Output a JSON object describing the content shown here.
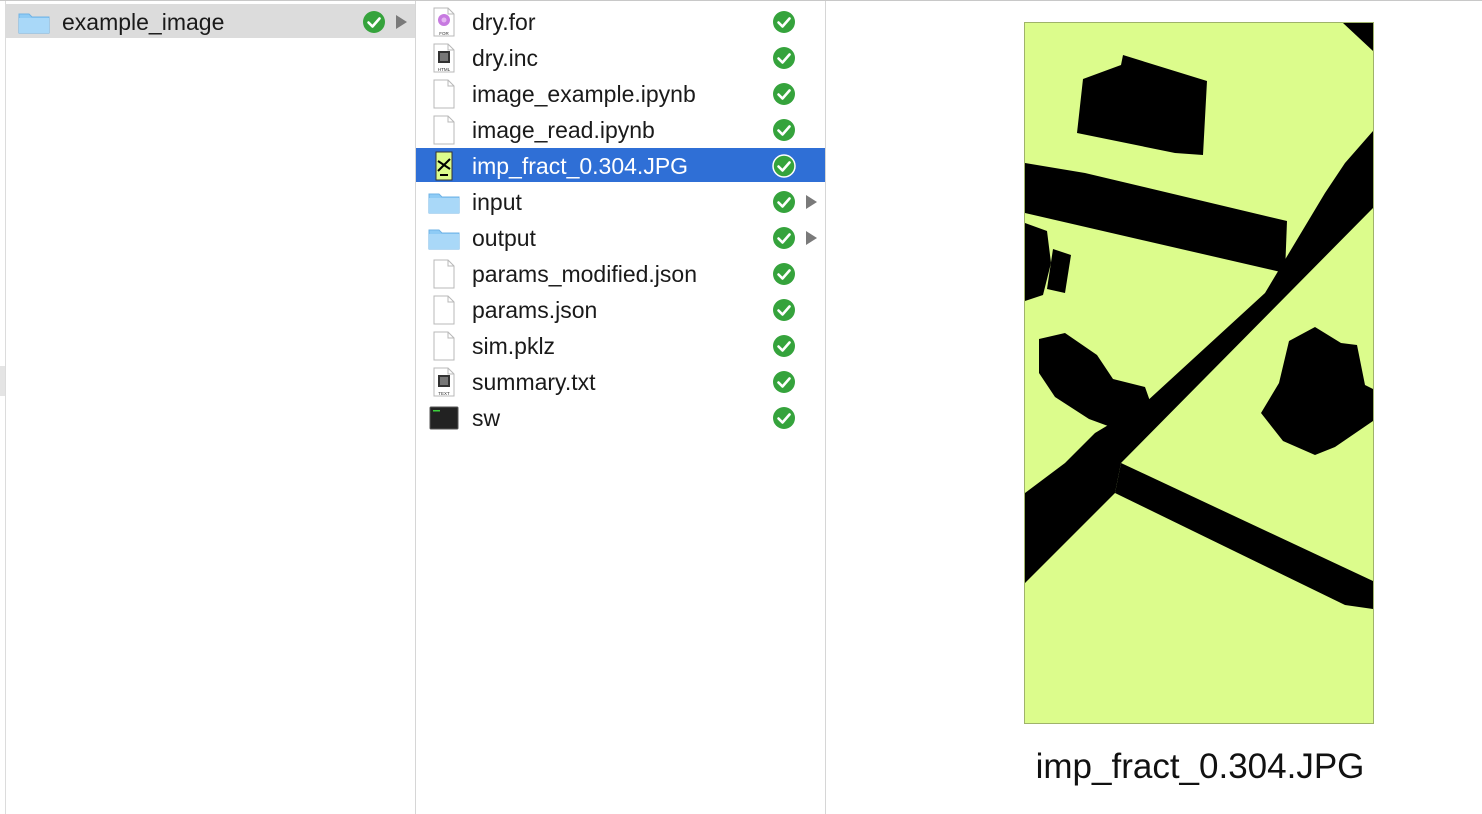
{
  "column1": {
    "items": [
      {
        "label": "example_image",
        "icon": "folder-icon",
        "synced": true,
        "has_children": true
      }
    ]
  },
  "column2": {
    "items": [
      {
        "label": "dry.for",
        "icon": "fortran-file-icon",
        "synced": true,
        "has_children": false,
        "selected": false,
        "icon_badge": "FOR"
      },
      {
        "label": "dry.inc",
        "icon": "html-file-icon",
        "synced": true,
        "has_children": false,
        "selected": false,
        "icon_badge": "HTML"
      },
      {
        "label": "image_example.ipynb",
        "icon": "blank-document-icon",
        "synced": true,
        "has_children": false,
        "selected": false
      },
      {
        "label": "image_read.ipynb",
        "icon": "blank-document-icon",
        "synced": true,
        "has_children": false,
        "selected": false
      },
      {
        "label": "imp_fract_0.304.JPG",
        "icon": "jpg-thumbnail-icon",
        "synced": true,
        "has_children": false,
        "selected": true
      },
      {
        "label": "input",
        "icon": "folder-icon",
        "synced": true,
        "has_children": true,
        "selected": false
      },
      {
        "label": "output",
        "icon": "folder-icon",
        "synced": true,
        "has_children": true,
        "selected": false
      },
      {
        "label": "params_modified.json",
        "icon": "blank-document-icon",
        "synced": true,
        "has_children": false,
        "selected": false
      },
      {
        "label": "params.json",
        "icon": "blank-document-icon",
        "synced": true,
        "has_children": false,
        "selected": false
      },
      {
        "label": "sim.pklz",
        "icon": "blank-document-icon",
        "synced": true,
        "has_children": false,
        "selected": false
      },
      {
        "label": "summary.txt",
        "icon": "text-file-icon",
        "synced": true,
        "has_children": false,
        "selected": false,
        "icon_badge": "TEXT"
      },
      {
        "label": "sw",
        "icon": "terminal-executable-icon",
        "synced": true,
        "has_children": false,
        "selected": false
      }
    ]
  },
  "preview": {
    "caption": "imp_fract_0.304.JPG",
    "image_background": "#dcfc8c",
    "image_foreground": "#000000"
  },
  "colors": {
    "selection": "#2f6fd6",
    "sync_check": "#35a33c",
    "folder": "#8ecbf5",
    "row_highlight": "#dcdcdc"
  }
}
